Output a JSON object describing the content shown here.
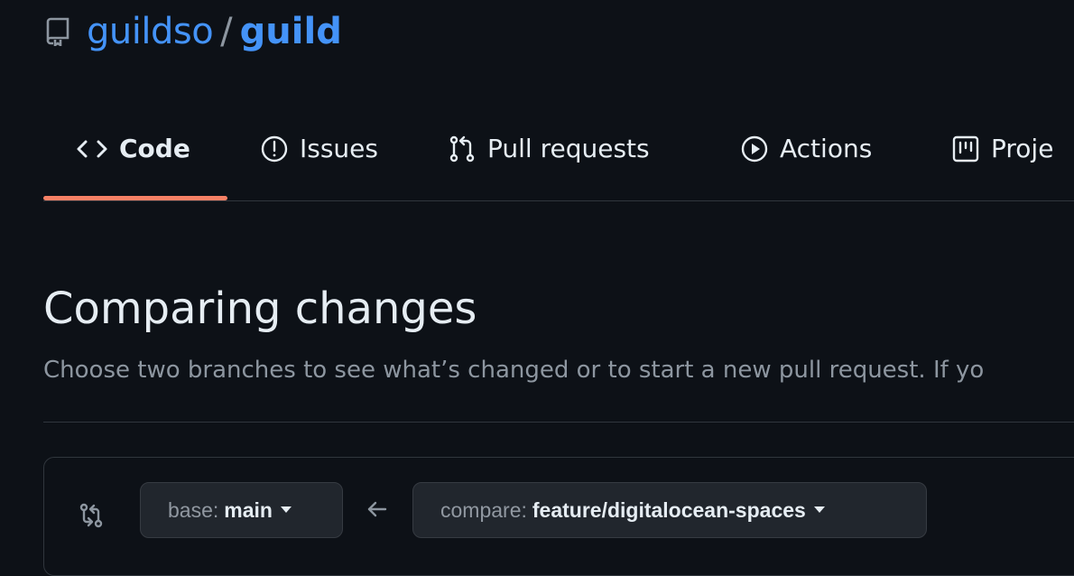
{
  "repo": {
    "owner": "guildso",
    "separator": "/",
    "name": "guild",
    "icon": "repo-icon"
  },
  "nav": {
    "tabs": [
      {
        "label": "Code",
        "icon": "code-icon",
        "selected": true
      },
      {
        "label": "Issues",
        "icon": "issue-opened-icon"
      },
      {
        "label": "Pull requests",
        "icon": "git-pull-request-icon"
      },
      {
        "label": "Actions",
        "icon": "play-icon"
      },
      {
        "label": "Proje",
        "icon": "project-icon"
      }
    ],
    "accent": "#f78166"
  },
  "main": {
    "title": "Comparing changes",
    "description": "Choose two branches to see what’s changed or to start a new pull request. If yo"
  },
  "compare": {
    "icon": "git-compare-icon",
    "base_label": "base:",
    "base_value": "main",
    "arrow_icon": "arrow-left-icon",
    "compare_label": "compare:",
    "compare_value": "feature/digitalocean-spaces"
  },
  "colors": {
    "background": "#0d1117",
    "link": "#4493f8",
    "muted": "#8d96a0",
    "border": "#30363d",
    "button_bg": "#21262d"
  }
}
